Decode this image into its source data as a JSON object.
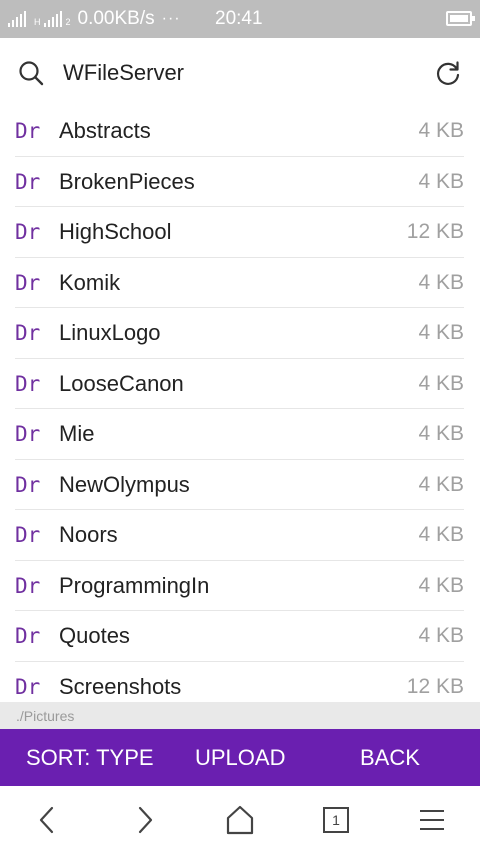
{
  "status_bar": {
    "network_label": "H",
    "sim_label": "2",
    "speed": "0.00KB/s",
    "dots": "···",
    "time": "20:41"
  },
  "header": {
    "title": "WFileServer"
  },
  "files": [
    {
      "type": "Dr",
      "name": "Abstracts",
      "size": "4 KB"
    },
    {
      "type": "Dr",
      "name": "BrokenPieces",
      "size": "4 KB"
    },
    {
      "type": "Dr",
      "name": "HighSchool",
      "size": "12 KB"
    },
    {
      "type": "Dr",
      "name": "Komik",
      "size": "4 KB"
    },
    {
      "type": "Dr",
      "name": "LinuxLogo",
      "size": "4 KB"
    },
    {
      "type": "Dr",
      "name": "LooseCanon",
      "size": "4 KB"
    },
    {
      "type": "Dr",
      "name": "Mie",
      "size": "4 KB"
    },
    {
      "type": "Dr",
      "name": "NewOlympus",
      "size": "4 KB"
    },
    {
      "type": "Dr",
      "name": "Noors",
      "size": "4 KB"
    },
    {
      "type": "Dr",
      "name": "ProgrammingIn",
      "size": "4 KB"
    },
    {
      "type": "Dr",
      "name": "Quotes",
      "size": "4 KB"
    },
    {
      "type": "Dr",
      "name": "Screenshots",
      "size": "12 KB"
    }
  ],
  "path": "./Pictures",
  "actions": {
    "sort_label": "SORT: TYPE",
    "upload_label": "UPLOAD",
    "back_label": "BACK"
  },
  "nav": {
    "tab_count": "1"
  },
  "colors": {
    "accent": "#6a1fb0",
    "type_tag": "#7030a0",
    "status_bar": "#bdbdbd"
  }
}
